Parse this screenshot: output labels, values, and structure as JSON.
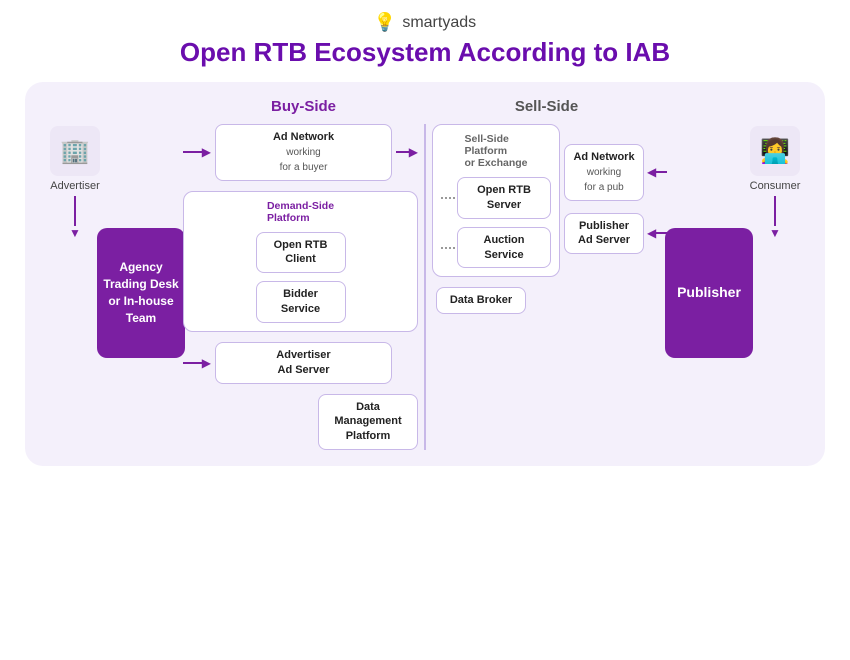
{
  "logo": {
    "icon": "💡",
    "text": "smartyads"
  },
  "title": "Open RTB Ecosystem According to IAB",
  "buy_side_label": "Buy-Side",
  "sell_side_label": "Sell-Side",
  "advertiser_label": "Advertiser",
  "consumer_label": "Consumer",
  "agency_box": {
    "line1": "Agency",
    "line2": "Trading Desk",
    "line3": "or In-house",
    "line4": "Team"
  },
  "publisher_box": "Publisher",
  "buy_nodes": {
    "ad_network": {
      "title": "Ad Network",
      "sub": "working\nfor a buyer"
    },
    "advertiser_ad_server": "Advertiser\nAd Server"
  },
  "dsp": {
    "title": "Demand-Side\nPlatform",
    "open_rtb_client": "Open RTB\nClient",
    "bidder_service": "Bidder\nService",
    "data_management": "Data\nManagement\nPlatform"
  },
  "ssp": {
    "title": "Sell-Side\nPlatform\nor Exchange",
    "open_rtb_server": "Open RTB\nServer",
    "auction_service": "Auction\nService",
    "data_broker": "Data Broker"
  },
  "sell_nodes": {
    "ad_network": {
      "title": "Ad Network",
      "sub": "working\nfor a pub"
    },
    "publisher_ad_server": "Publisher\nAd Server"
  }
}
